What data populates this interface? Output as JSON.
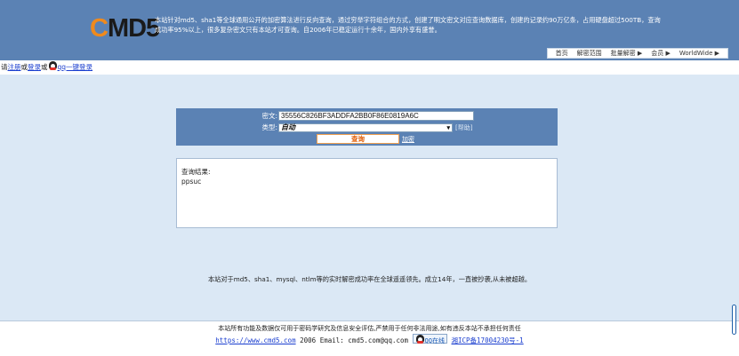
{
  "header": {
    "logo_c": "C",
    "logo_rest": "MD5",
    "tagline": "本站针对md5、sha1等全球通用公开的加密算法进行反向查询，通过穷举字符组合的方式，创建了明文密文对应查询数据库，创建的记录约90万亿条，占用硬盘超过500TB，查询成功率95%以上，很多复杂密文只有本站才可查询。自2006年已稳定运行十余年，国内外享有盛誉。",
    "nav": [
      "首页",
      "解密范围",
      "批量解密 ▶",
      "会员 ▶",
      "WorldWide ▶"
    ]
  },
  "login": {
    "prefix": "请",
    "register": "注册",
    "or1": "或",
    "login": "登录",
    "or2": "或",
    "qq_login": "qq一键登录"
  },
  "form": {
    "hash_label": "密文:",
    "hash_value": "35556C826BF3ADDFA2BB0F86E0819A6C",
    "type_label": "类型:",
    "type_value": "自动",
    "help": "[帮助]",
    "query_button": "查询",
    "encrypt_link": "加密"
  },
  "result": {
    "title": "查询结果:",
    "value": "ppsuc"
  },
  "intro": "本站对于md5、sha1、mysql、ntlm等的实时解密成功率在全球遥遥领先。成立14年，一直被抄袭,从未被超越。",
  "footer": {
    "disclaimer": "本站所有功能及数据仅可用于密码学研究及信息安全评估,严禁用于任何非法用途,如有违反本站不承担任何责任",
    "url": "https://www.cmd5.com",
    "year": "2006",
    "email": "Email: cmd5.com@qq.com",
    "qq_badge": "QQ在线",
    "icp": "湘ICP备17004230号-1"
  }
}
